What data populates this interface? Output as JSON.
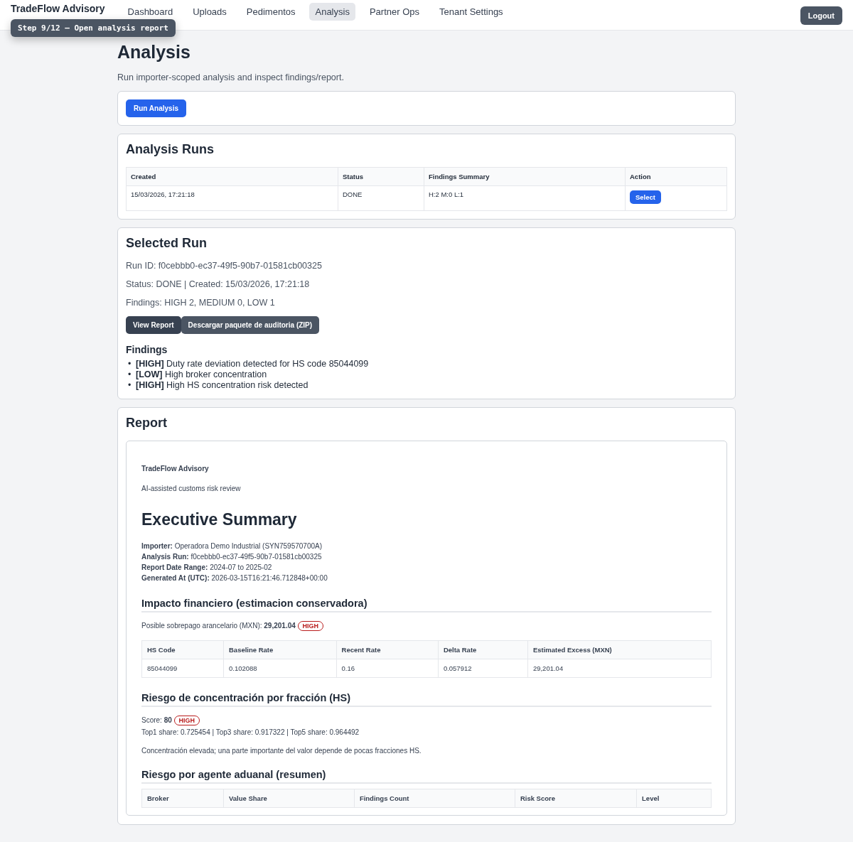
{
  "nav": {
    "brand": "TradeFlow Advisory",
    "items": [
      {
        "label": "Dashboard",
        "selected": false
      },
      {
        "label": "Uploads",
        "selected": false
      },
      {
        "label": "Pedimentos",
        "selected": false
      },
      {
        "label": "Analysis",
        "selected": true
      },
      {
        "label": "Partner Ops",
        "selected": false
      },
      {
        "label": "Tenant Settings",
        "selected": false
      }
    ],
    "logout": "Logout"
  },
  "tour_tooltip": "Step 9/12 — Open analysis report",
  "page": {
    "title": "Analysis",
    "subtitle": "Run importer-scoped analysis and inspect findings/report."
  },
  "run_button": "Run Analysis",
  "runs": {
    "title": "Analysis Runs",
    "columns": [
      "Created",
      "Status",
      "Findings Summary",
      "Action"
    ],
    "rows": [
      {
        "created": "15/03/2026, 17:21:18",
        "status": "DONE",
        "summary": "H:2 M:0 L:1",
        "action": "Select"
      }
    ]
  },
  "selected_run": {
    "title": "Selected Run",
    "lines": [
      "Run ID: f0cebbb0-ec37-49f5-90b7-01581cb00325",
      "Status: DONE | Created: 15/03/2026, 17:21:18",
      "Findings: HIGH 2, MEDIUM 0, LOW 1"
    ],
    "buttons": [
      "View Report",
      "Descargar paquete de auditoria (ZIP)"
    ],
    "findings_title": "Findings",
    "findings": [
      {
        "bullet": "•",
        "text": "**[HIGH]** Duty rate deviation detected for HS code 85044099"
      },
      {
        "bullet": "•",
        "text": "**[LOW]** High broker concentration"
      },
      {
        "bullet": "•",
        "text": "**[HIGH]** High HS concentration risk detected"
      }
    ]
  },
  "report": {
    "title": "Report",
    "brand": "TradeFlow Advisory",
    "tagline": "AI-assisted customs risk review",
    "heading": "Executive Summary",
    "meta": [
      "**Importer:** Operadora Demo Industrial (SYN759570700A)",
      "**Analysis Run:** f0cebbb0-ec37-49f5-90b7-01581cb00325",
      "**Report Date Range:** 2024-07 to 2025-02",
      "**Generated At (UTC):** 2026-03-15T16:21:46.712848+00:00"
    ],
    "financial": {
      "title": "Impacto financiero (estimacion conservadora)",
      "text": "Posible sobrepago arancelario (MXN): **29,201.04**",
      "badge": "HIGH",
      "columns": [
        "HS Code",
        "Baseline Rate",
        "Recent Rate",
        "Delta Rate",
        "Estimated Excess (MXN)"
      ],
      "rows": [
        [
          "85044099",
          "0.102088",
          "0.16",
          "0.057912",
          "29,201.04"
        ]
      ]
    },
    "hs_risk": {
      "title": "Riesgo de concentración por fracción (HS)",
      "score": "Score: **80**",
      "badge": "HIGH",
      "shares": "Top1 share: 0.725454 | Top3 share: 0.917322 | Top5 share: 0.964492",
      "note": "Concentración elevada; una parte importante del valor depende de pocas fracciones HS."
    },
    "broker": {
      "title": "Riesgo por agente aduanal (resumen)",
      "columns": [
        "Broker",
        "Value Share",
        "Findings Count",
        "Risk Score",
        "Level"
      ]
    }
  }
}
